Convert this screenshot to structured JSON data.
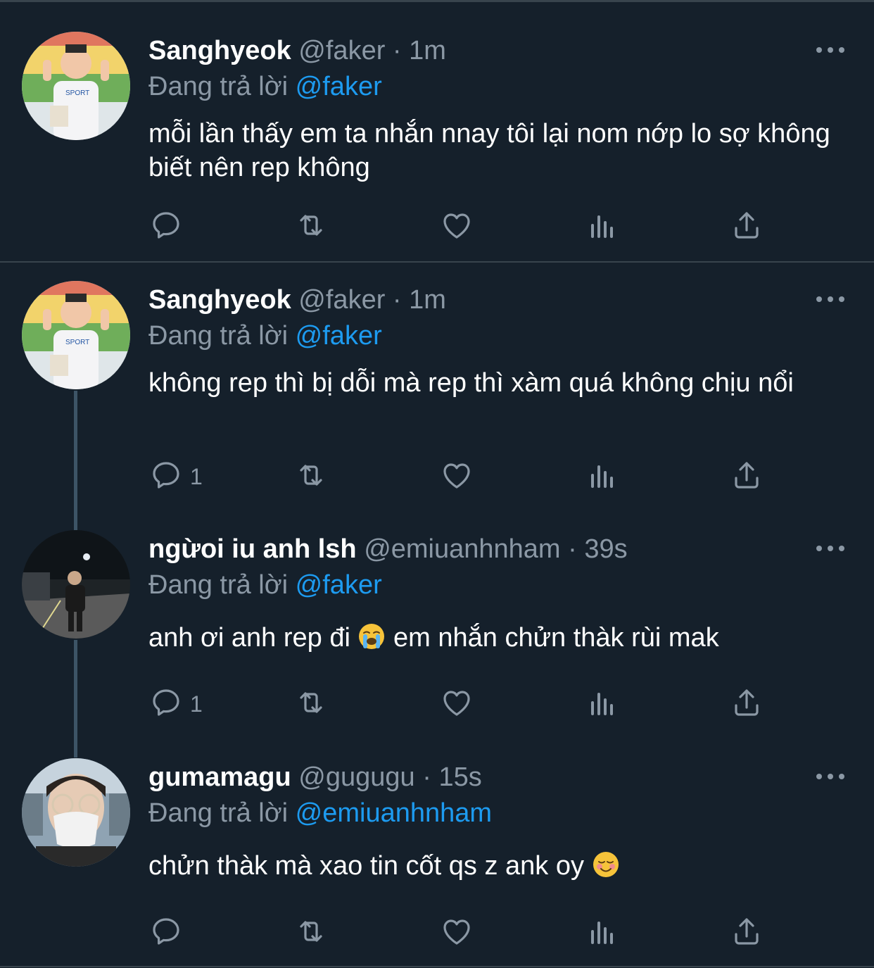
{
  "thread": {
    "tweets": [
      {
        "name": "Sanghyeok",
        "handle": "@faker",
        "time": "1m",
        "replying_prefix": "Đang trả lời",
        "replying_to": "@faker",
        "text": "mỗi lần thấy em ta nhắn nnay tôi lại nom nớp lo sợ không biết nên rep không",
        "reply_count": "",
        "avatar": "child-photo"
      },
      {
        "name": "Sanghyeok",
        "handle": "@faker",
        "time": "1m",
        "replying_prefix": "Đang trả lời",
        "replying_to": "@faker",
        "text": "không rep thì bị dỗi mà rep thì xàm quá không chịu nổi",
        "reply_count": "1",
        "avatar": "child-photo"
      },
      {
        "name": "ngừoi iu anh lsh",
        "handle": "@emiuanhnham",
        "time": "39s",
        "replying_prefix": "Đang trả lời",
        "replying_to": "@faker",
        "text_before": "anh ơi anh rep đi",
        "emoji": "loudly-crying-face",
        "text_after": "em nhắn chửn thàk rùi mak",
        "reply_count": "1",
        "avatar": "night-walk-photo"
      },
      {
        "name": "gumamagu",
        "handle": "@gugugu",
        "time": "15s",
        "replying_prefix": "Đang trả lời",
        "replying_to": "@emiuanhnham",
        "text_before": "chửn thàk mà xao tin cốt qs z ank oy",
        "emoji": "smiling-face",
        "reply_count": "",
        "avatar": "masked-face-photo"
      }
    ]
  },
  "colors": {
    "background": "#15202b",
    "separator": "#38444d",
    "secondary_text": "#8b98a5",
    "mention": "#1d9bf0",
    "thread_line": "#3d5466"
  },
  "icons": [
    "reply-icon",
    "retweet-icon",
    "like-icon",
    "analytics-icon",
    "share-icon",
    "more-icon"
  ]
}
